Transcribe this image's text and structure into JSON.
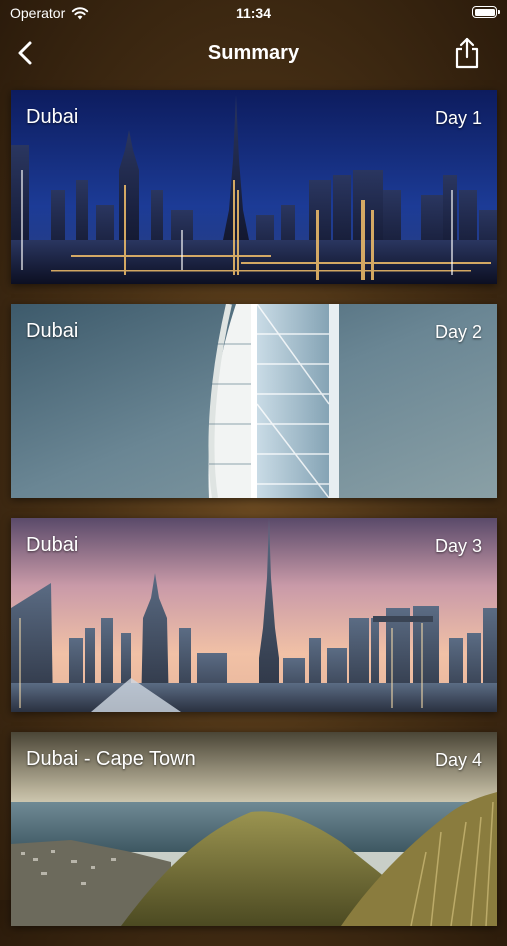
{
  "status_bar": {
    "carrier": "Operator",
    "time": "11:34"
  },
  "nav": {
    "title": "Summary",
    "back_icon": "chevron-left-icon",
    "share_icon": "share-icon"
  },
  "colors": {
    "background": "#4a3216",
    "text": "#ffffff"
  },
  "cards": [
    {
      "title": "Dubai",
      "day": "Day 1",
      "image": "dubai-night-skyline"
    },
    {
      "title": "Dubai",
      "day": "Day 2",
      "image": "burj-al-arab"
    },
    {
      "title": "Dubai",
      "day": "Day 3",
      "image": "dubai-sunset-skyline"
    },
    {
      "title": "Dubai - Cape Town",
      "day": "Day 4",
      "image": "cape-town-signal-hill"
    }
  ]
}
